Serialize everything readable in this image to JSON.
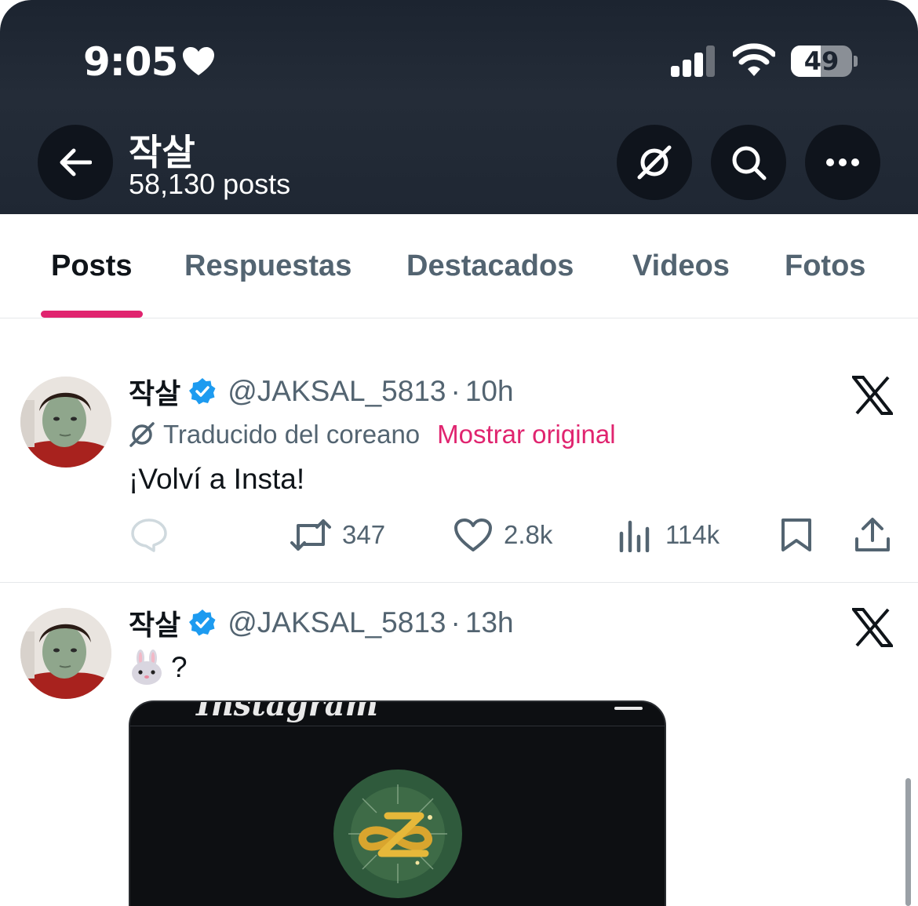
{
  "status_bar": {
    "time": "9:05",
    "battery": "49",
    "battery_level": 0.49
  },
  "header": {
    "profile_name": "작살",
    "post_count": "58,130 posts",
    "icons": [
      "back-arrow-icon",
      "translate-icon",
      "search-icon",
      "more-icon"
    ]
  },
  "tabs": [
    {
      "label": "Posts",
      "active": true
    },
    {
      "label": "Respuestas",
      "active": false
    },
    {
      "label": "Destacados",
      "active": false
    },
    {
      "label": "Videos",
      "active": false
    },
    {
      "label": "Fotos",
      "active": false
    }
  ],
  "posts": [
    {
      "author": "작살",
      "handle": "@JAKSAL_5813",
      "separator": "·",
      "time": "10h",
      "translated_label": "Traducido del coreano",
      "show_original": "Mostrar original",
      "text": "¡Volví a Insta!",
      "retweets": "347",
      "likes": "2.8k",
      "views": "114k"
    },
    {
      "author": "작살",
      "handle": "@JAKSAL_5813",
      "separator": "·",
      "time": "13h",
      "text": "?",
      "emoji": "rabbit-face-icon",
      "media_wordmark": "Instagram"
    }
  ],
  "colors": {
    "accent": "#e0246f",
    "header_bg": "#1f2733",
    "verified": "#1d9bf0",
    "secondary_text": "#536471"
  }
}
